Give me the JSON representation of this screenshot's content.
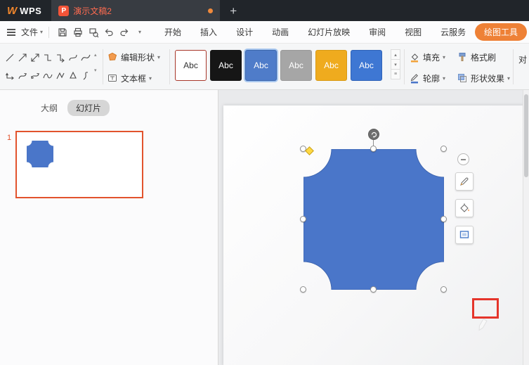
{
  "titlebar": {
    "brand_mark": "W",
    "brand": "WPS",
    "doc_tab": {
      "file_badge": "P",
      "title": "演示文稿2"
    },
    "new_tab": "+"
  },
  "menubar": {
    "file_label": "文件",
    "tabs": [
      {
        "label": "开始"
      },
      {
        "label": "插入"
      },
      {
        "label": "设计"
      },
      {
        "label": "动画"
      },
      {
        "label": "幻灯片放映"
      },
      {
        "label": "审阅"
      },
      {
        "label": "视图"
      },
      {
        "label": "云服务"
      }
    ],
    "drawing_tools": "绘图工具",
    "clipped_item": "对"
  },
  "toolbar": {
    "edit_shape": "编辑形状",
    "text_box": "文本框",
    "style_tiles": [
      {
        "label": "Abc",
        "bg": "#ffffff",
        "fg": "#333333",
        "border": "#a8372a",
        "selected": false
      },
      {
        "label": "Abc",
        "bg": "#161616",
        "fg": "#ffffff",
        "border": "#161616",
        "selected": false
      },
      {
        "label": "Abc",
        "bg": "#4f7cc9",
        "fg": "#ffffff",
        "border": "#3c66ad",
        "selected": true
      },
      {
        "label": "Abc",
        "bg": "#a6a6a6",
        "fg": "#ffffff",
        "border": "#999999",
        "selected": false
      },
      {
        "label": "Abc",
        "bg": "#efab1e",
        "fg": "#ffffff",
        "border": "#d89a15",
        "selected": false
      },
      {
        "label": "Abc",
        "bg": "#3e77d3",
        "fg": "#ffffff",
        "border": "#2f63b8",
        "selected": false
      }
    ],
    "fill": "填充",
    "outline": "轮廓",
    "format_painter": "格式刷",
    "shape_effects": "形状效果"
  },
  "sidebar": {
    "outline_tab": "大纲",
    "slides_tab": "幻灯片",
    "slide_number": "1"
  },
  "canvas": {
    "shape_fill": "#4a76c9",
    "shape_stroke": "#3f66b0"
  },
  "colors": {
    "accent_orange": "#ee8136",
    "doc_tab_text": "#ff6b50",
    "selection_red": "#e2532d",
    "annotation_red": "#e5352b"
  }
}
